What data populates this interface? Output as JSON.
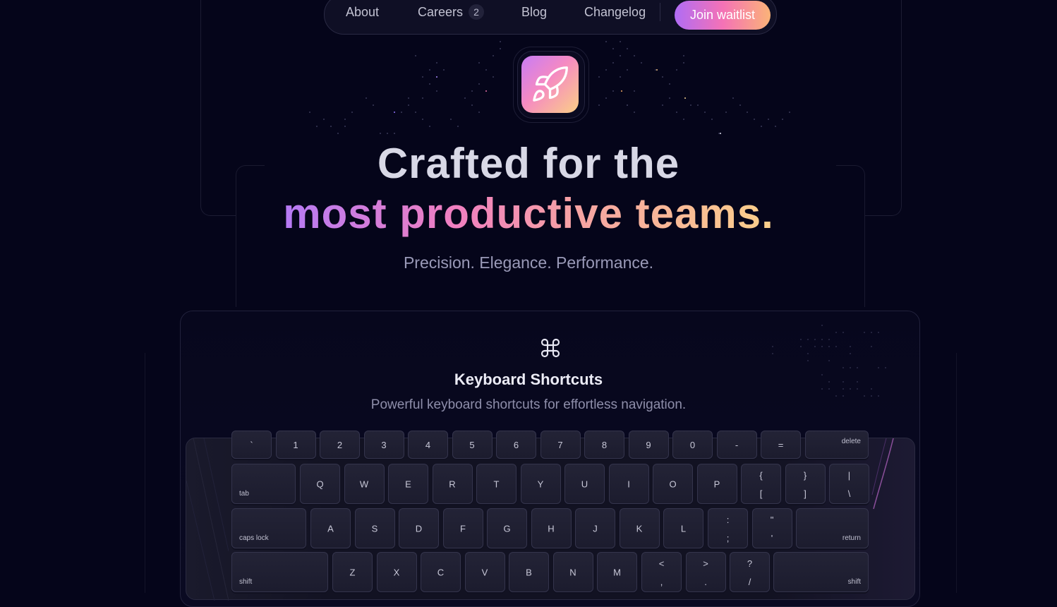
{
  "nav": {
    "items": [
      {
        "label": "About"
      },
      {
        "label": "Careers",
        "badge": "2"
      },
      {
        "label": "Blog"
      },
      {
        "label": "Changelog"
      }
    ],
    "cta": "Join waitlist"
  },
  "hero": {
    "line1": "Crafted for the",
    "line2": "most productive teams.",
    "tagline": "Precision. Elegance. Performance."
  },
  "feature": {
    "title": "Keyboard Shortcuts",
    "subtitle": "Powerful keyboard shortcuts for effortless navigation."
  },
  "keyboard": {
    "row0": [
      "`",
      "1",
      "2",
      "3",
      "4",
      "5",
      "6",
      "7",
      "8",
      "9",
      "0",
      "-",
      "=",
      "delete"
    ],
    "row1": [
      "tab",
      "Q",
      "W",
      "E",
      "R",
      "T",
      "Y",
      "U",
      "I",
      "O",
      "P"
    ],
    "row1_dual": [
      [
        "{",
        "["
      ],
      [
        "}",
        "]"
      ],
      [
        "|",
        "\\"
      ]
    ],
    "row2": [
      "caps lock",
      "A",
      "S",
      "D",
      "F",
      "G",
      "H",
      "J",
      "K",
      "L"
    ],
    "row2_dual": [
      [
        ":",
        ";"
      ],
      [
        "\"",
        "'"
      ]
    ],
    "row2_end": "return",
    "row3": [
      "shift",
      "Z",
      "X",
      "C",
      "V",
      "B",
      "N",
      "M"
    ],
    "row3_dual": [
      [
        "<",
        ","
      ],
      [
        ">",
        "."
      ],
      [
        "?",
        "/"
      ]
    ],
    "row3_end": "shift"
  },
  "colors": {
    "background": "#05051a",
    "gradient_start": "#b57af5",
    "gradient_mid": "#f07fc0",
    "gradient_end": "#fbd08a"
  },
  "icons": [
    "rocket-icon",
    "command-icon"
  ]
}
